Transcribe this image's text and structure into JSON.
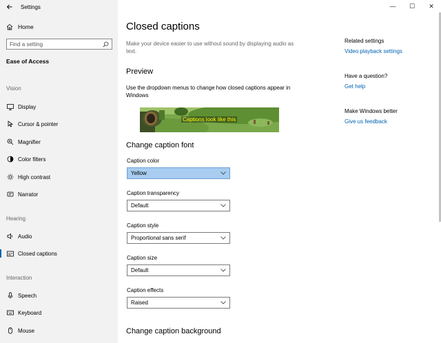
{
  "window": {
    "title": "Settings",
    "controls": {
      "minimize": "—",
      "maximize": "☐",
      "close": "✕"
    }
  },
  "sidebar": {
    "home_label": "Home",
    "search_placeholder": "Find a setting",
    "section_title": "Ease of Access",
    "groups": {
      "vision": "Vision",
      "hearing": "Hearing",
      "interaction": "Interaction"
    },
    "items": {
      "display": "Display",
      "cursor": "Cursor & pointer",
      "magnifier": "Magnifier",
      "color_filters": "Color filters",
      "high_contrast": "High contrast",
      "narrator": "Narrator",
      "audio": "Audio",
      "closed_captions": "Closed captions",
      "speech": "Speech",
      "keyboard": "Keyboard",
      "mouse": "Mouse"
    },
    "active_item": "closed_captions"
  },
  "main": {
    "title": "Closed captions",
    "description": "Make your device easier to use without sound by displaying audio as text.",
    "preview_heading": "Preview",
    "preview_description": "Use the dropdown menus to change how closed captions appear in Windows",
    "preview_caption": "Captions look like this",
    "caption_font_heading": "Change caption font",
    "fields": {
      "color": {
        "label": "Caption color",
        "value": "Yellow"
      },
      "transparency": {
        "label": "Caption transparency",
        "value": "Default"
      },
      "style": {
        "label": "Caption style",
        "value": "Proportional sans serif"
      },
      "size": {
        "label": "Caption size",
        "value": "Default"
      },
      "effects": {
        "label": "Caption effects",
        "value": "Raised"
      }
    },
    "caption_background_heading": "Change caption background"
  },
  "right_panel": {
    "related_heading": "Related settings",
    "related_link": "Video playback settings",
    "question_heading": "Have a question?",
    "question_link": "Get help",
    "better_heading": "Make Windows better",
    "better_link": "Give us feedback"
  },
  "colors": {
    "accent": "#0063b1",
    "sidebar_bg": "#f2f2f2",
    "dropdown_highlight": "#a8cdf0",
    "caption_text": "#ffff00"
  }
}
